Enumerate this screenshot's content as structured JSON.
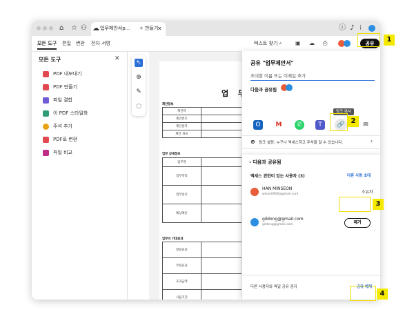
{
  "browser": {
    "tab_title": "업무제안서p...",
    "new_tab_label": "만들기"
  },
  "menu": {
    "all_tools": "모든 도구",
    "edit": "편집",
    "convert": "변환",
    "esign": "전자 서명",
    "search_text": "텍스트 찾기",
    "share_button": "공유"
  },
  "sidebar": {
    "title": "모든 도구",
    "items": [
      {
        "label": "PDF 내보내기",
        "color": "#e34850"
      },
      {
        "label": "PDF 만들기",
        "color": "#e34850"
      },
      {
        "label": "파일 결합",
        "color": "#6e5bd6"
      },
      {
        "label": "이 PDF 스타일화",
        "color": "#2d9d78"
      },
      {
        "label": "주석 추가",
        "color": "#e8a317"
      },
      {
        "label": "PDF로 변환",
        "color": "#e34850"
      },
      {
        "label": "파일 비교",
        "color": "#c02a85"
      }
    ]
  },
  "document": {
    "title": "업 무 제 안",
    "section_basic": "제안정보",
    "rows_basic": [
      "제안자",
      "제안번호",
      "제안일자",
      "제안 개요"
    ],
    "section_detail": "업무 상세정보",
    "rows_detail": [
      "업무명",
      "업무목적",
      "업무방식",
      "예상예산"
    ],
    "section_effect": "업무의 기대효과",
    "rows_effect": [
      "정량효과",
      "부정효과",
      "효과금액",
      "사용기간"
    ]
  },
  "share_panel": {
    "title": "공유 \"업무제안서\"",
    "invite_placeholder": "초대할 이름 또는 이메일 추가",
    "shared_with_label": "다음과 공유됨",
    "tooltip": "링크 복사",
    "link_settings": "링크 설정: 누구나 액세스하고 주석을 달 수 있습니다.",
    "shared_card": {
      "back_label": "다음과 공유됨",
      "access_label": "액세스 권한이 있는 사용자 (3)",
      "invite_others": "다른 사람 초대",
      "users": [
        {
          "name": "HAN MINSEON",
          "email": "wlsan0920@gmail.com",
          "role": "소유자"
        },
        {
          "name": "gildong@gmail.com",
          "email": "gildong@gmail.com",
          "role": "제거"
        }
      ]
    },
    "footer_text": "다른 사용자와 파일 공유 중지",
    "stop_sharing": "공유 해제"
  },
  "callouts": [
    "1",
    "2",
    "3",
    "4"
  ],
  "colors": {
    "highlight": "#f5e900",
    "accent": "#2d6fd8"
  },
  "icons": [
    "home-icon",
    "star-icon",
    "people-icon",
    "cloud-icon",
    "search-icon",
    "save-icon",
    "print-icon",
    "close-icon",
    "cursor-icon",
    "zoom-icon",
    "pen-icon",
    "lasso-icon",
    "outlook-icon",
    "gmail-icon",
    "whatsapp-icon",
    "teams-icon",
    "link-icon",
    "mail-icon",
    "globe-icon"
  ]
}
